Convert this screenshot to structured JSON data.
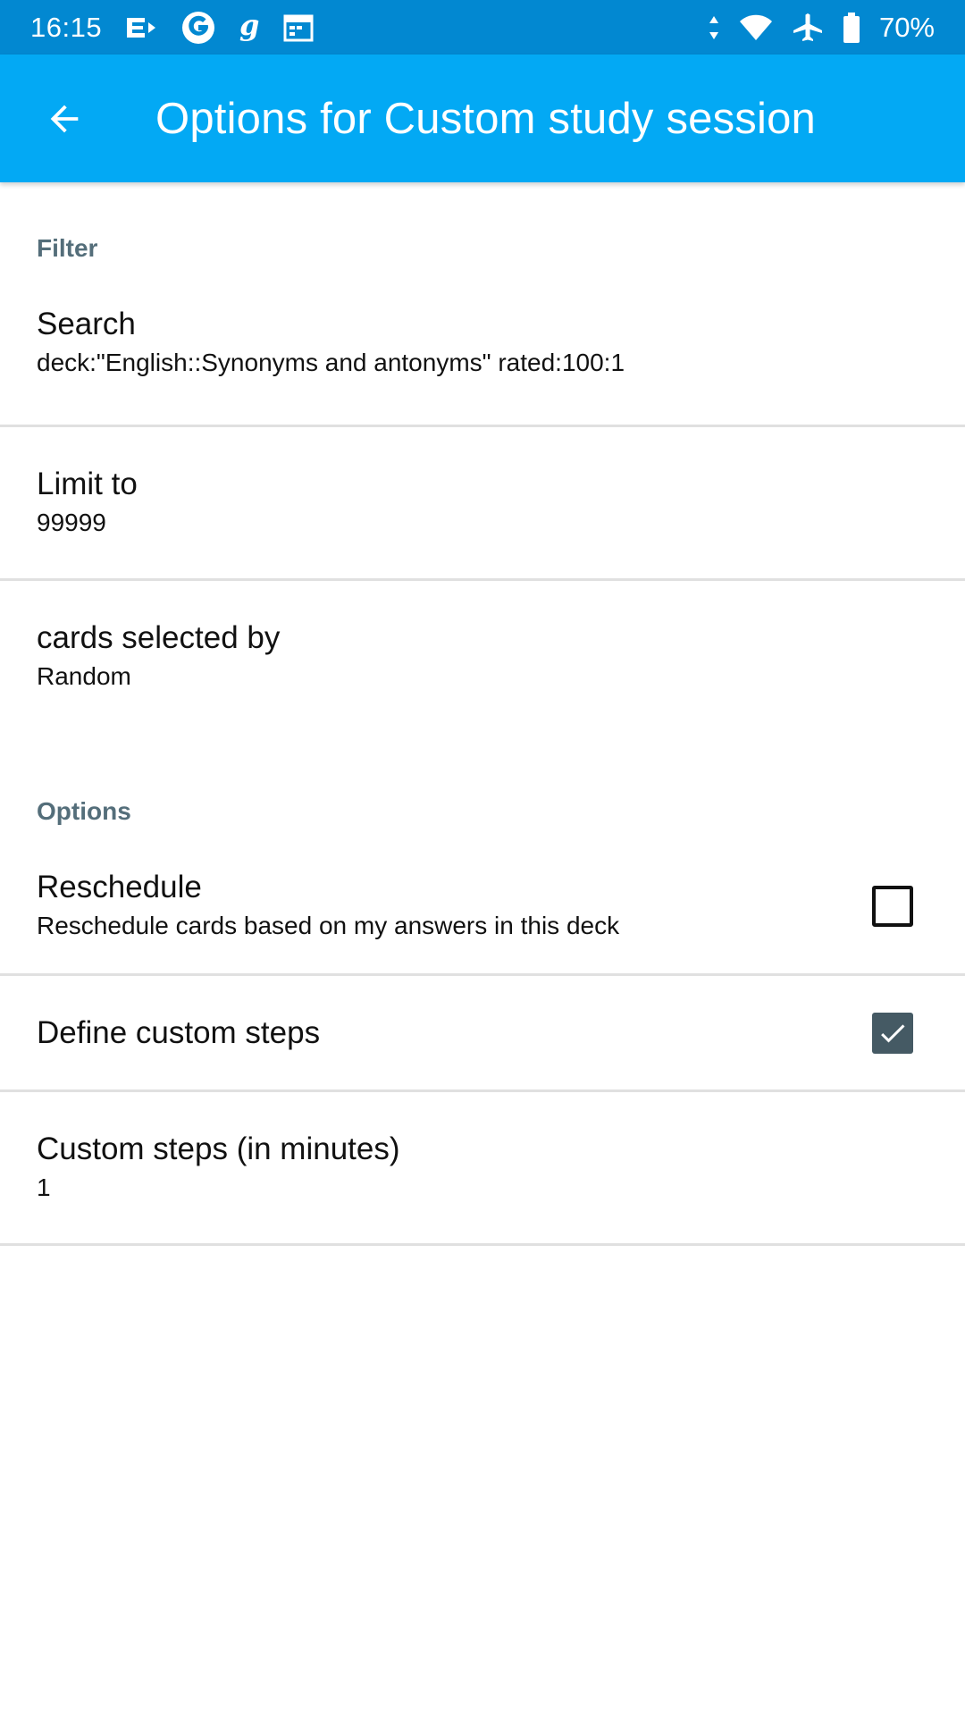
{
  "status_bar": {
    "time": "16:15",
    "battery": "70%",
    "left_icons": [
      "mail-arrow-icon",
      "google-icon",
      "goodreads-icon",
      "calendar-icon"
    ],
    "right_icons": [
      "data-arrows-icon",
      "wifi-icon",
      "airplane-icon",
      "battery-icon"
    ]
  },
  "app_bar": {
    "title": "Options for Custom study session",
    "back_icon": "arrow-back-icon",
    "background": "#03a9f4"
  },
  "sections": {
    "filter": {
      "header": "Filter",
      "search": {
        "title": "Search",
        "summary": "deck:\"English::Synonyms and antonyms\" rated:100:1"
      },
      "limit": {
        "title": "Limit to",
        "summary": "99999"
      },
      "cards_selected": {
        "title": "cards selected by",
        "summary": "Random"
      }
    },
    "options": {
      "header": "Options",
      "reschedule": {
        "title": "Reschedule",
        "summary": "Reschedule cards based on my answers in this deck",
        "checked": false
      },
      "custom_steps": {
        "title": "Define custom steps",
        "checked": true
      },
      "steps_minutes": {
        "title": "Custom steps (in minutes)",
        "summary": "1"
      }
    }
  },
  "colors": {
    "status_bar": "#0288d1",
    "category_text": "#546e7a",
    "checkbox_checked": "#455a64"
  }
}
